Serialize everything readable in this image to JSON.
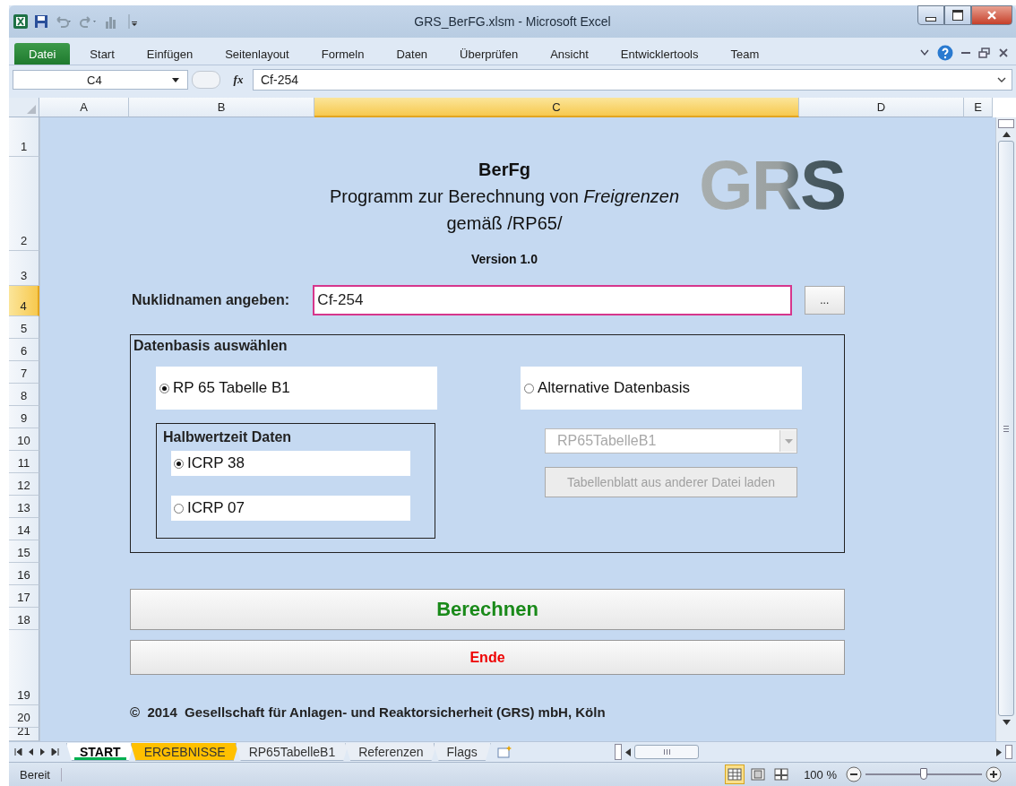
{
  "window": {
    "title": "GRS_BerFG.xlsm  -  Microsoft Excel"
  },
  "ribbon_tabs": [
    {
      "label": "Datei",
      "kind": "file",
      "selected": false
    },
    {
      "label": "Start",
      "kind": "tab",
      "selected": false
    },
    {
      "label": "Einfügen",
      "kind": "tab",
      "selected": false
    },
    {
      "label": "Seitenlayout",
      "kind": "tab",
      "selected": false
    },
    {
      "label": "Formeln",
      "kind": "tab",
      "selected": false
    },
    {
      "label": "Daten",
      "kind": "tab",
      "selected": false
    },
    {
      "label": "Überprüfen",
      "kind": "tab",
      "selected": false
    },
    {
      "label": "Ansicht",
      "kind": "tab",
      "selected": false
    },
    {
      "label": "Entwicklertools",
      "kind": "tab",
      "selected": false
    },
    {
      "label": "Team",
      "kind": "tab",
      "selected": false
    }
  ],
  "formula_bar": {
    "name_box": "C4",
    "function_button": "fx",
    "formula": "Cf-254"
  },
  "columns": [
    {
      "label": "A",
      "selected": false
    },
    {
      "label": "B",
      "selected": false
    },
    {
      "label": "C",
      "selected": true
    },
    {
      "label": "D",
      "selected": false
    },
    {
      "label": "E",
      "selected": false
    }
  ],
  "rows": [
    {
      "label": "1",
      "selected": false
    },
    {
      "label": "2",
      "selected": false
    },
    {
      "label": "3",
      "selected": false
    },
    {
      "label": "4",
      "selected": true
    },
    {
      "label": "5",
      "selected": false
    },
    {
      "label": "6",
      "selected": false
    },
    {
      "label": "7",
      "selected": false
    },
    {
      "label": "8",
      "selected": false
    },
    {
      "label": "9",
      "selected": false
    },
    {
      "label": "10",
      "selected": false
    },
    {
      "label": "11",
      "selected": false
    },
    {
      "label": "12",
      "selected": false
    },
    {
      "label": "13",
      "selected": false
    },
    {
      "label": "14",
      "selected": false
    },
    {
      "label": "15",
      "selected": false
    },
    {
      "label": "16",
      "selected": false
    },
    {
      "label": "17",
      "selected": false
    },
    {
      "label": "18",
      "selected": false
    },
    {
      "label": "19",
      "selected": false
    },
    {
      "label": "20",
      "selected": false
    },
    {
      "label": "21",
      "selected": false
    }
  ],
  "form": {
    "title": "BerFg",
    "subtitle": "Programm zur Berechnung von *Freigrenzen*",
    "subtitle_2": "gemäß /RP65/",
    "logo": "GRS",
    "version": "Version 1.0",
    "nuclide_label": "Nuklidnamen angeben:",
    "nuclide_value": "Cf-254",
    "browse_button": "...",
    "database_group": {
      "title": "Datenbasis auswählen",
      "options": [
        {
          "label": "RP 65 Tabelle B1",
          "selected": true
        },
        {
          "label": "Alternative Datenbasis",
          "selected": false
        }
      ],
      "half_life_group": {
        "title": "Halbwertzeit Daten",
        "options": [
          {
            "label": "ICRP 38",
            "selected": true
          },
          {
            "label": "ICRP 07",
            "selected": false
          }
        ]
      },
      "table_select": {
        "value": "RP65TabelleB1",
        "disabled": true
      },
      "load_button": {
        "label": "Tabellenblatt aus anderer Datei laden",
        "disabled": true
      }
    },
    "calculate_button": "Berechnen",
    "end_button": "Ende",
    "copyright": "©  2014  Gesellschaft für Anlagen- und Reaktorsicherheit (GRS) mbH, Köln"
  },
  "sheet_tabs": [
    {
      "label": "START",
      "selected": true,
      "color": "#00b050"
    },
    {
      "label": "ERGEBNISSE",
      "selected": false,
      "color": "#ffc000"
    },
    {
      "label": "RP65TabelleB1",
      "selected": false
    },
    {
      "label": "Referenzen",
      "selected": false
    },
    {
      "label": "Flags",
      "selected": false
    }
  ],
  "status_bar": {
    "status": "Bereit",
    "views": [
      {
        "kind": "normal",
        "selected": true
      },
      {
        "kind": "page_layout",
        "selected": false
      },
      {
        "kind": "page_break",
        "selected": false
      }
    ],
    "zoom": "100 %",
    "zoom_slider": {
      "level": 0.5
    }
  }
}
